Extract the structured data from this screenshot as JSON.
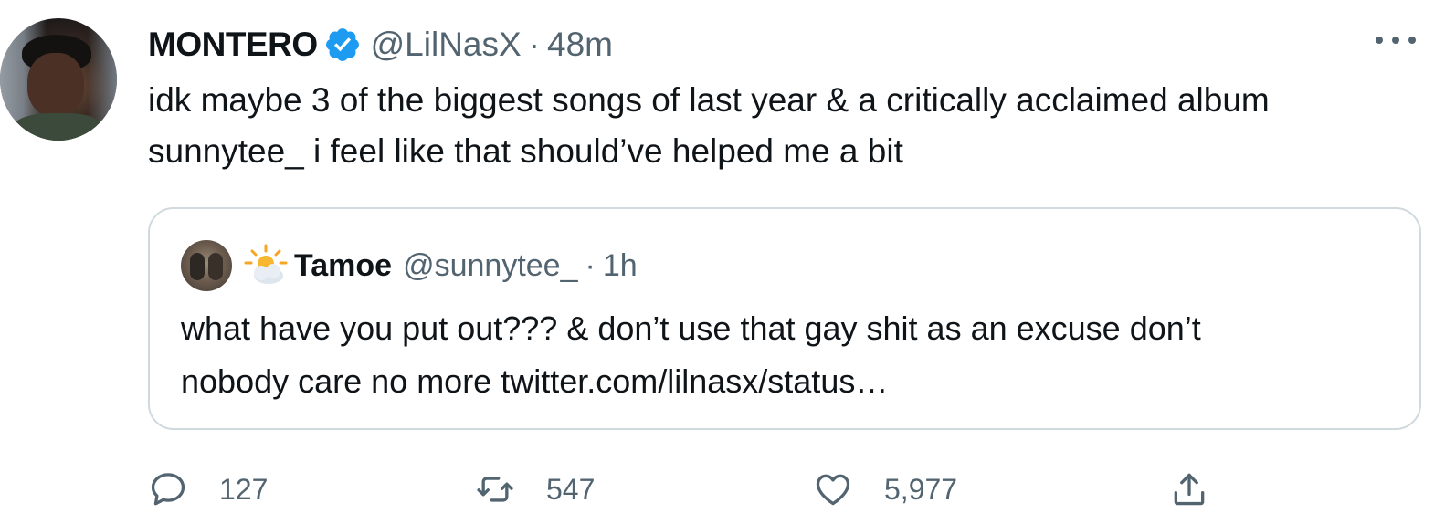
{
  "tweet": {
    "display_name": "MONTERO",
    "verified": true,
    "handle": "@LilNasX",
    "separator": "·",
    "time": "48m",
    "text_lines": [
      "idk maybe 3 of the biggest songs of last year & a critically acclaimed album",
      "sunnytee_ i feel like that should’ve helped me a bit"
    ]
  },
  "quote": {
    "display_name": "Tamoe",
    "name_emoji": "sun-behind-cloud-icon",
    "handle": "@sunnytee_",
    "separator": "·",
    "time": "1h",
    "text_lines": [
      "what have you put out??? & don’t use that gay shit as an excuse don’t",
      "nobody care no more twitter.com/lilnasx/status…"
    ]
  },
  "actions": {
    "reply_count": "127",
    "retweet_count": "547",
    "like_count": "5,977"
  },
  "colors": {
    "text": "#0f1419",
    "secondary": "#536471",
    "verified_badge": "#1d9bf0",
    "border": "#cfd9de"
  }
}
